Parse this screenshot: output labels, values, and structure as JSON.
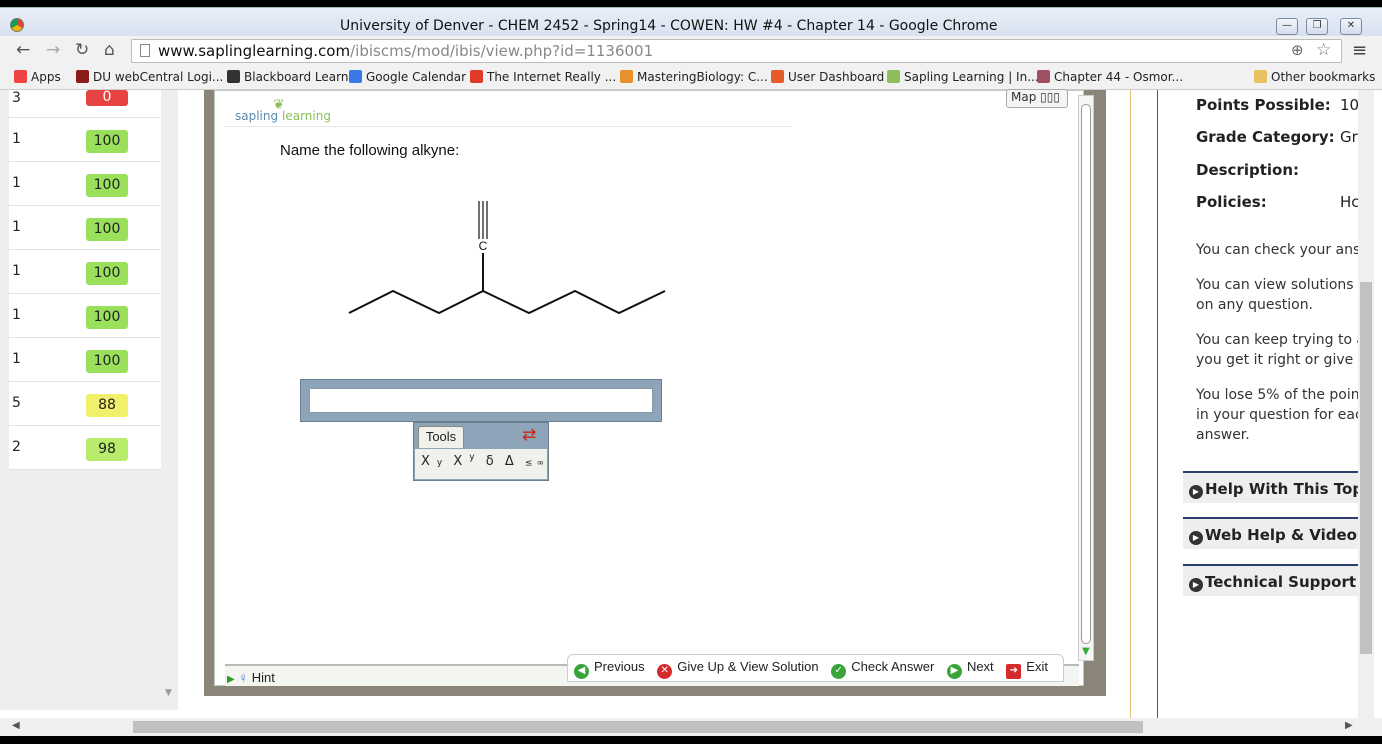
{
  "window": {
    "title": "University of Denver - CHEM 2452 - Spring14 - COWEN: HW #4 - Chapter 14 - Google Chrome"
  },
  "address": {
    "host": "www.saplinglearning.com",
    "path": "/ibiscms/mod/ibis/view.php?id=1136001"
  },
  "bookmarks": [
    {
      "label": "Apps",
      "color": "#e44"
    },
    {
      "label": "DU webCentral Logi...",
      "color": "#8b1a1a"
    },
    {
      "label": "Blackboard Learn",
      "color": "#333"
    },
    {
      "label": "Google Calendar",
      "color": "#3b78e7"
    },
    {
      "label": "The Internet Really ...",
      "color": "#e03a2a"
    },
    {
      "label": "MasteringBiology: C...",
      "color": "#e8902a"
    },
    {
      "label": "User Dashboard",
      "color": "#e55b2a"
    },
    {
      "label": "Sapling Learning | In...",
      "color": "#8cbf5a"
    },
    {
      "label": "Chapter 44 - Osmor...",
      "color": "#a05060"
    },
    {
      "label": "Other bookmarks",
      "color": "#e8c060"
    }
  ],
  "scores": [
    {
      "num": "3",
      "score": "0",
      "color": "#e84343"
    },
    {
      "num": "1",
      "score": "100",
      "color": "#9be05a"
    },
    {
      "num": "1",
      "score": "100",
      "color": "#9be05a"
    },
    {
      "num": "1",
      "score": "100",
      "color": "#9be05a"
    },
    {
      "num": "1",
      "score": "100",
      "color": "#9be05a"
    },
    {
      "num": "1",
      "score": "100",
      "color": "#9be05a"
    },
    {
      "num": "1",
      "score": "100",
      "color": "#9be05a"
    },
    {
      "num": "5",
      "score": "88",
      "color": "#f0f06a"
    },
    {
      "num": "2",
      "score": "98",
      "color": "#b8ec6a"
    }
  ],
  "question": {
    "logo_a": "sapling",
    "logo_b": "learning",
    "map_label": "Map",
    "prompt": "Name the following alkyne:",
    "atom_label": "C",
    "answer_value": "",
    "tools_label": "Tools",
    "tools": [
      "X",
      "X",
      "δ",
      "Δ",
      "≤",
      "∞"
    ]
  },
  "actions": {
    "hint": "Hint",
    "previous": "Previous",
    "give_up": "Give Up & View Solution",
    "check": "Check Answer",
    "next": "Next",
    "exit": "Exit"
  },
  "info": {
    "points_label": "Points Possible:",
    "points_value": "10",
    "grade_label": "Grade Category:",
    "grade_value": "Gr",
    "description_label": "Description:",
    "policies_label": "Policies:",
    "policies_value": "Hc",
    "policy_1": "You can check your ans",
    "policy_2": "You can view solutions up on any question.",
    "policy_3": "You can keep trying to a you get it right or give u",
    "policy_4": "You lose 5% of the poin in your question for eac answer.",
    "help_1": "Help With This Top",
    "help_2": "Web Help & Videos",
    "help_3": "Technical Support"
  }
}
